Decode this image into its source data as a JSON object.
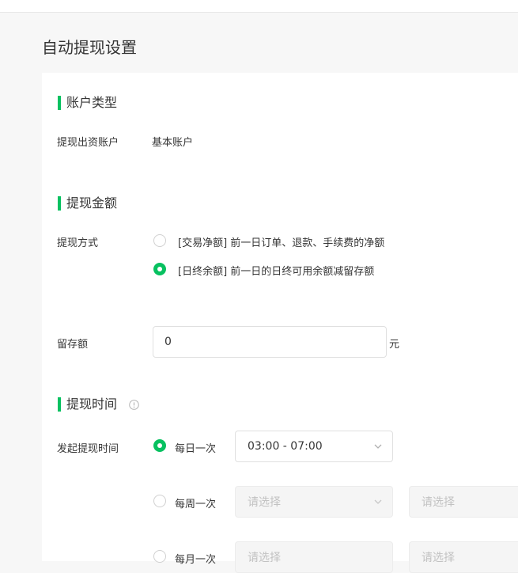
{
  "page": {
    "title": "自动提现设置"
  },
  "account_section": {
    "title": "账户类型",
    "label": "提现出资账户",
    "value": "基本账户"
  },
  "amount_section": {
    "title": "提现金额",
    "method_label": "提现方式",
    "options": [
      {
        "label": "[交易净额] 前一日订单、退款、手续费的净额",
        "checked": false
      },
      {
        "label": "[日终余额] 前一日的日终可用余额减留存额",
        "checked": true
      }
    ],
    "reserve_label": "留存额",
    "reserve_value": "0",
    "reserve_unit": "元"
  },
  "time_section": {
    "title": "提现时间",
    "info_icon": "info-circle-icon",
    "label": "发起提现时间",
    "frequencies": [
      {
        "label": "每日一次",
        "checked": true,
        "select1": "03:00 - 07:00",
        "select2": ""
      },
      {
        "label": "每周一次",
        "checked": false,
        "select1": "请选择",
        "select2": "请选择"
      },
      {
        "label": "每月一次",
        "checked": false,
        "select1": "请选择",
        "select2": "请选择"
      }
    ]
  },
  "colors": {
    "accent": "#07c160",
    "background": "#f7f7f7",
    "placeholder": "#c2c2c2"
  }
}
